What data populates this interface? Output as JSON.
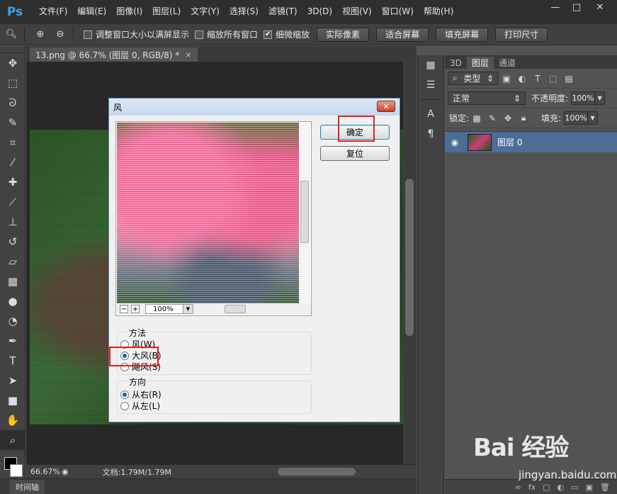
{
  "app": {
    "logo": "Ps",
    "menu": [
      "文件(F)",
      "编辑(E)",
      "图像(I)",
      "图层(L)",
      "文字(Y)",
      "选择(S)",
      "滤镜(T)",
      "3D(D)",
      "视图(V)",
      "窗口(W)",
      "帮助(H)"
    ],
    "window_controls": {
      "minimize": "—",
      "maximize": "□",
      "close": "✕"
    }
  },
  "options": {
    "checks": [
      {
        "label": "调整窗口大小以满屏显示",
        "checked": false
      },
      {
        "label": "缩放所有窗口",
        "checked": false
      },
      {
        "label": "细微缩放",
        "checked": true
      }
    ],
    "buttons": [
      "实际像素",
      "适合屏幕",
      "填充屏幕",
      "打印尺寸"
    ]
  },
  "tools": [
    "move-icon",
    "marquee-icon",
    "lasso-icon",
    "quick-select-icon",
    "crop-icon",
    "eyedropper-icon",
    "healing-icon",
    "brush-icon",
    "stamp-icon",
    "history-brush-icon",
    "eraser-icon",
    "gradient-icon",
    "blur-icon",
    "dodge-icon",
    "pen-icon",
    "type-icon",
    "path-select-icon",
    "rectangle-icon",
    "hand-icon",
    "zoom-icon"
  ],
  "document": {
    "tab_title": "13.png @ 66.7% (图层 0, RGB/8) *",
    "tab_close": "×",
    "zoom": "66.67%",
    "doc_info": "文档:1.79M/1.79M",
    "timeline_tab": "时间轴"
  },
  "layers_panel": {
    "tabs": [
      "3D",
      "图层",
      "通道"
    ],
    "active_tab": "图层",
    "filter_label": "类型",
    "blend_mode": "正常",
    "opacity_label": "不透明度:",
    "opacity_value": "100%",
    "lock_label": "锁定:",
    "fill_label": "填充:",
    "fill_value": "100%",
    "layers": [
      {
        "name": "图层 0",
        "visible": true
      }
    ],
    "footer_icons": [
      "∞",
      "fx",
      "▢",
      "◐",
      "▭",
      "▣",
      "🗑"
    ]
  },
  "wind_dialog": {
    "title": "风",
    "close": "✕",
    "ok_label": "确定",
    "reset_label": "复位",
    "zoom_value": "100%",
    "zoom_minus": "−",
    "zoom_plus": "+",
    "method": {
      "title": "方法",
      "options": [
        "风(W)",
        "大风(B)",
        "飓风(S)"
      ],
      "selected": "大风(B)"
    },
    "direction": {
      "title": "方向",
      "options": [
        "从右(R)",
        "从左(L)"
      ],
      "selected": "从右(R)"
    }
  },
  "watermark": {
    "logo": "Bai 经验",
    "text": "jingyan.baidu.com"
  }
}
